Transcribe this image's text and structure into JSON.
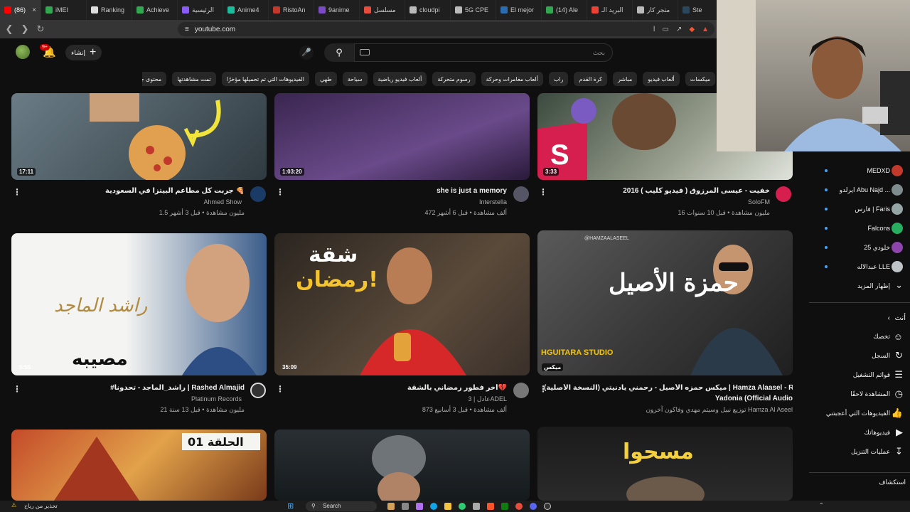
{
  "browser": {
    "tabs": [
      {
        "label": "(86)",
        "color": "#ff0000",
        "active": true
      },
      {
        "label": "iMEI",
        "color": "#2fa84f"
      },
      {
        "label": "Ranking",
        "color": "#dddddd"
      },
      {
        "label": "Achieve",
        "color": "#2fa84f"
      },
      {
        "label": "الرئيسية",
        "color": "#8a5cf6"
      },
      {
        "label": "Anime4",
        "color": "#1abc9c"
      },
      {
        "label": "RistoAn",
        "color": "#c0392b"
      },
      {
        "label": "9anime",
        "color": "#7b4bc6"
      },
      {
        "label": "مسلسل",
        "color": "#e74c3c"
      },
      {
        "label": "cloudpi",
        "color": "#bbbbbb"
      },
      {
        "label": "5G CPE",
        "color": "#bbbbbb"
      },
      {
        "label": "El mejor",
        "color": "#2b6cb0"
      },
      {
        "label": "(14) Ale",
        "color": "#2fa84f"
      },
      {
        "label": "البريد الـ",
        "color": "#ea4335"
      },
      {
        "label": "متجر كار",
        "color": "#bbbbbb"
      },
      {
        "label": "Ste",
        "color": "#2a475e"
      }
    ],
    "url": "youtube.com"
  },
  "header": {
    "search_placeholder": "بحث",
    "create_label": "إنشاء",
    "notif_count": "9+"
  },
  "chips": [
    "ميكسات",
    "ألعاب فيديو",
    "مباشر",
    "كرة القدم",
    "راب",
    "ألعاب مغامرات وحركة",
    "رسوم متحركة",
    "ألعاب فيديو رياضية",
    "سياحة",
    "طهي",
    "الفيديوهات التي تم تحميلها مؤخرًا",
    "تمت مشاهدتها",
    "محتوى جديد لك"
  ],
  "videos": [
    {
      "title": "جربت كل مطاعم البيتزا في السعودية 🍕",
      "channel": "Ahmed Show",
      "meta": "1.5 مليون مشاهدة • قبل 3 أشهر",
      "duration": "17:11"
    },
    {
      "title": "she is just a memory",
      "channel": "Interstella",
      "meta": "472 ألف مشاهدة • قبل 6 أشهر",
      "duration": "1:03:20"
    },
    {
      "title": "خفيت - عيسى المرزوق ( فيديو كليب ) 2016",
      "channel": "SoloFM",
      "meta": "16 مليون مشاهدة • قبل 10 سنوات",
      "duration": "3:33"
    },
    {
      "title": "#راشد_الماجد - تحدونا | Rashed Almajid",
      "channel": "Platinum Records",
      "meta": "21 مليون مشاهدة • قبل 13 سنة",
      "duration": "5:55"
    },
    {
      "title": "أخر فطور رمضاني بالشقة💔",
      "channel": "عادل | 3ADEL",
      "meta": "873 ألف مشاهدة • قبل 3 أسابيع",
      "duration": "35:09"
    },
    {
      "title": "ميكس حمزه الأصيل - رحمني يادنيتي (النسخة الأصلية) | Hamza Alaasel - Rahamny)",
      "title2": "Yadonia  (Official Audio",
      "channel": "توزيع نبيل وسيتم مهدي وفاكون آخرون Hamza Al Aseel",
      "meta": "",
      "duration": "ميكس"
    },
    {
      "title": "",
      "channel": "",
      "meta": "",
      "duration": ""
    },
    {
      "title": "",
      "channel": "",
      "meta": "",
      "duration": ""
    },
    {
      "title": "",
      "channel": "",
      "meta": "",
      "duration": ""
    }
  ],
  "thumb_text": {
    "v4_sig": "راشد الماجد",
    "v4_word": "مصيبه",
    "v5_top": "شقة",
    "v5_bottom": "رمضان!",
    "v6_name": "حمزة الأصيل",
    "v6_studio": "HGUITARA STUDIO",
    "v6_handle": "@HAMZAALASEEL",
    "v7_ep": "الحلقة 01",
    "v9_word": "مسحوا"
  },
  "subscriptions": [
    {
      "label": "MEDXD",
      "color": "#c0392b"
    },
    {
      "label": "ايرلدو Abu Najd ...",
      "color": "#7f8c8d"
    },
    {
      "label": "فارس | Faris",
      "color": "#95a5a6"
    },
    {
      "label": "Falcons",
      "color": "#27ae60"
    },
    {
      "label": "خلودي 25",
      "color": "#8e44ad"
    },
    {
      "label": "عبدالاله LLE",
      "color": "#bdc3c7"
    }
  ],
  "sidebar": {
    "show_more": "إظهار المزيد",
    "you_header": "أنت",
    "you_items": [
      "تخصك",
      "السجل",
      "قوائم التشغيل",
      "المشاهدة لاحقًا",
      "الفيديوهات التي أعجبتني",
      "فيديوهاتك",
      "عمليات التنزيل"
    ],
    "explore": "استكشاف"
  },
  "taskbar": {
    "search": "Search",
    "weather": "تحذير من رياح"
  }
}
